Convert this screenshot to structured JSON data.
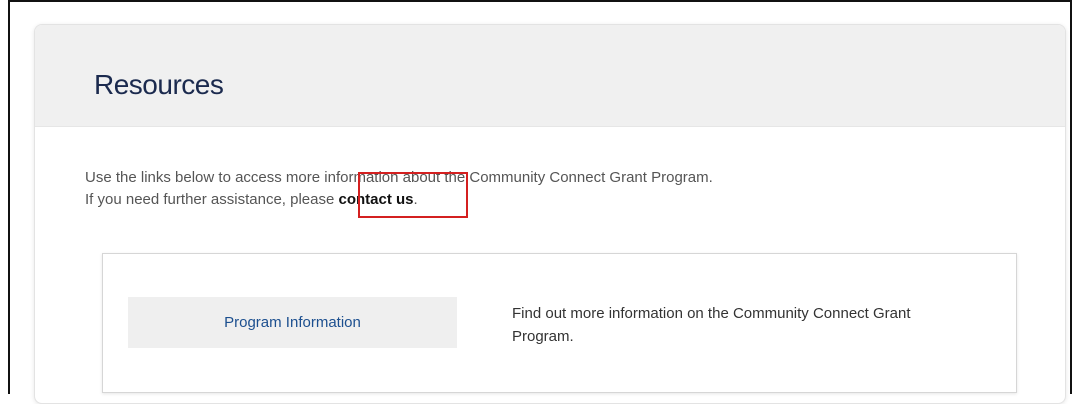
{
  "section": {
    "title": "Resources",
    "intro_line1": "Use the links below to access more information about the Community Connect Grant Program.",
    "intro_line2_prefix": "If you need further assistance, please ",
    "contact_link_label": "contact us",
    "intro_line2_suffix": "."
  },
  "resources": [
    {
      "button_label": "Program Information",
      "description": "Find out more information on the Community Connect Grant Program."
    }
  ],
  "colors": {
    "title": "#1b2a4e",
    "link_button_text": "#1c4f8f",
    "header_bg": "#f0f0f0",
    "highlight": "#d42020"
  }
}
